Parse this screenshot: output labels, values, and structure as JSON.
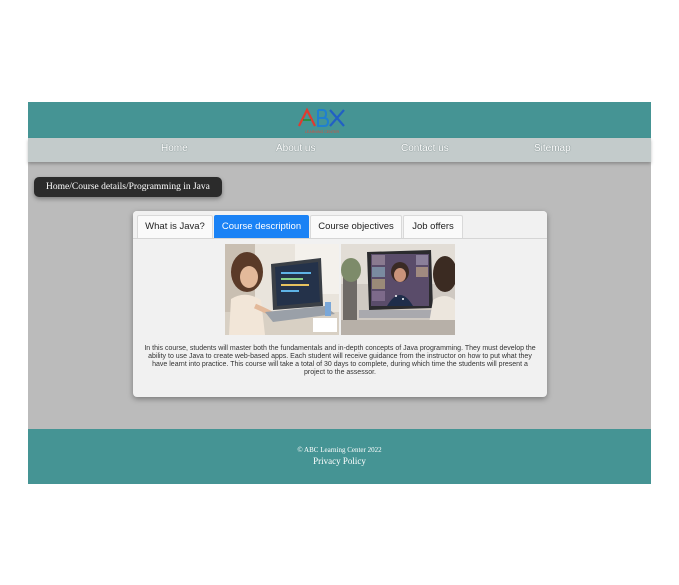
{
  "header": {
    "logo_text": "LEARNING CENTER",
    "colors": {
      "background": "#459494",
      "nav": "#c3cbcb"
    }
  },
  "nav": {
    "items": [
      "Home",
      "About us",
      "Contact us",
      "Sitemap"
    ]
  },
  "breadcrumb": "Home/Course details/Programming in Java",
  "tabs": [
    {
      "label": "What is Java?",
      "active": false
    },
    {
      "label": "Course description",
      "active": true
    },
    {
      "label": "Course objectives",
      "active": false
    },
    {
      "label": "Job offers",
      "active": false
    }
  ],
  "content": {
    "description": "In this course, students will master both the fundamentals and in-depth concepts of Java programming. They must develop the ability to use Java to create web-based apps. Each student will receive guidance from the instructor on how to put what they have learnt into practice. This course will take a total of 30 days to complete, during which time the students will present a project to the assessor."
  },
  "footer": {
    "copyright": "© ABC Learning Center 2022",
    "privacy": "Privacy Policy"
  },
  "accent_color": "#1a82f5"
}
